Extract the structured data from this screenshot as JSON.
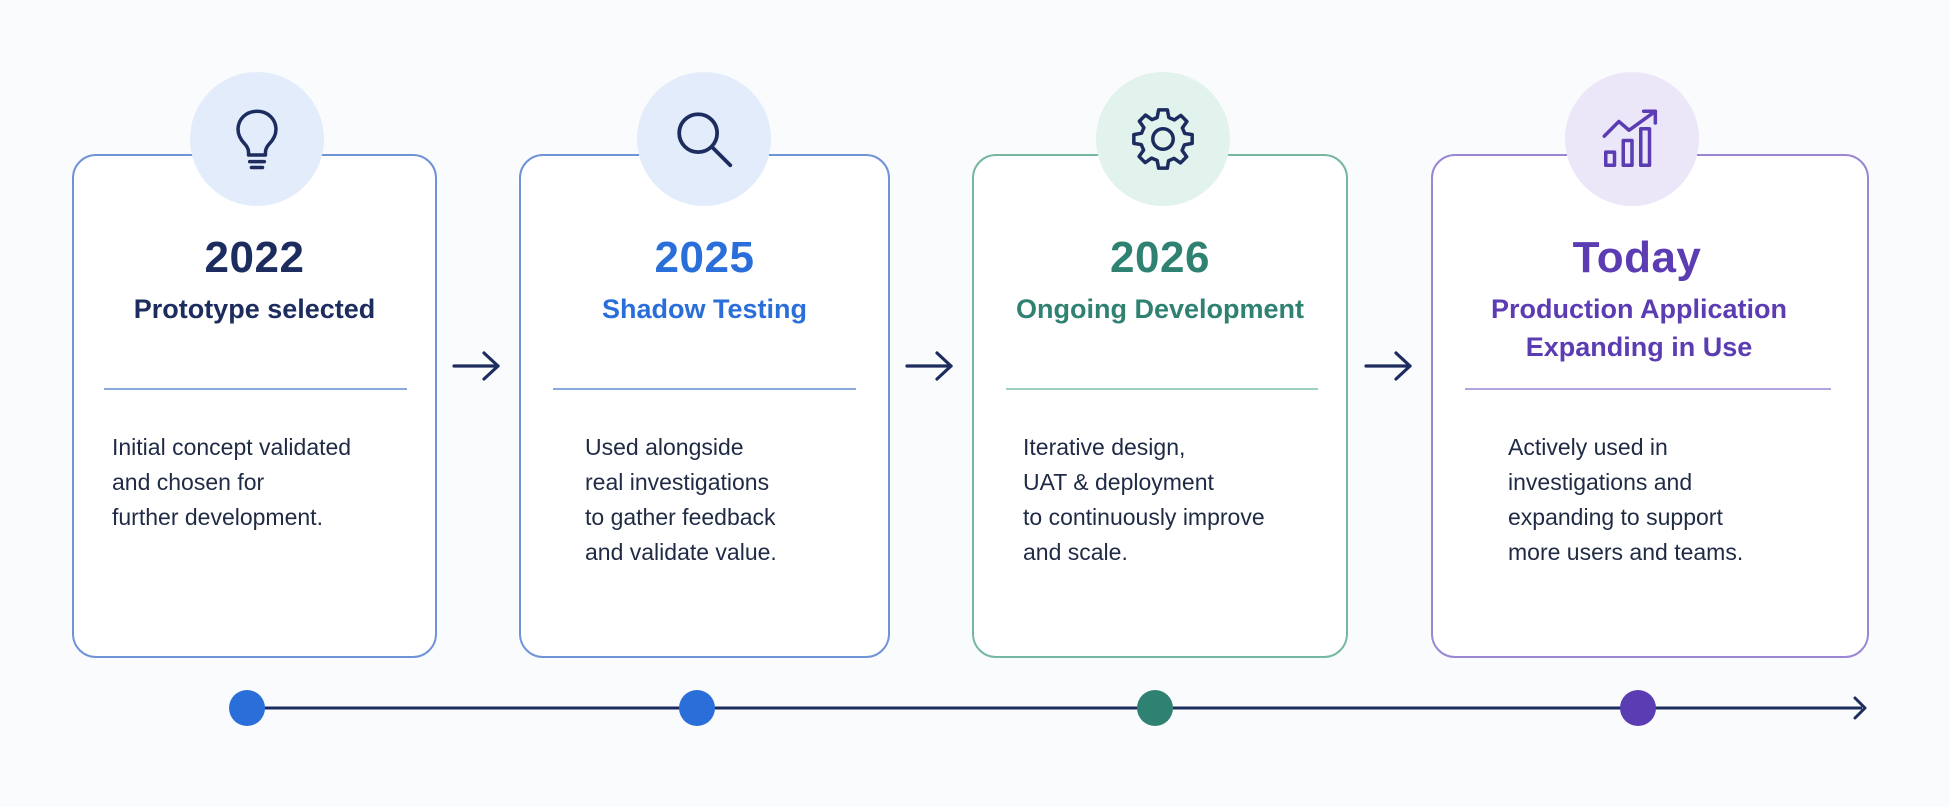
{
  "colors": {
    "background": "#fafbfd",
    "navy": "#1c2c5e",
    "blue": "#2a6fd9",
    "teal": "#2f8272",
    "purple": "#5b3cb2",
    "body_text": "#1f2a44",
    "blue_border": "#6f93d6",
    "teal_border": "#76b7a4",
    "purple_border": "#9b86d4",
    "blue_circle": "#e3ecfa",
    "teal_circle": "#e2f2ec",
    "purple_circle": "#ebe6f8"
  },
  "stages": [
    {
      "year": "2022",
      "title": "Prototype selected",
      "description": "Initial concept validated\nand chosen for\nfurther development.",
      "icon": "lightbulb-icon"
    },
    {
      "year": "2025",
      "title": "Shadow Testing",
      "description": "Used alongside\nreal investigations\nto gather feedback\nand validate value.",
      "icon": "magnifier-icon"
    },
    {
      "year": "2026",
      "title": "Ongoing Development",
      "description": "Iterative design,\nUAT & deployment\nto continuously improve\nand scale.",
      "icon": "gear-icon"
    },
    {
      "year": "Today",
      "title": "Production Application\nExpanding in Use",
      "description": "Actively used in\ninvestigations and\nexpanding to support\nmore users and teams.",
      "icon": "growth-chart-icon"
    }
  ]
}
